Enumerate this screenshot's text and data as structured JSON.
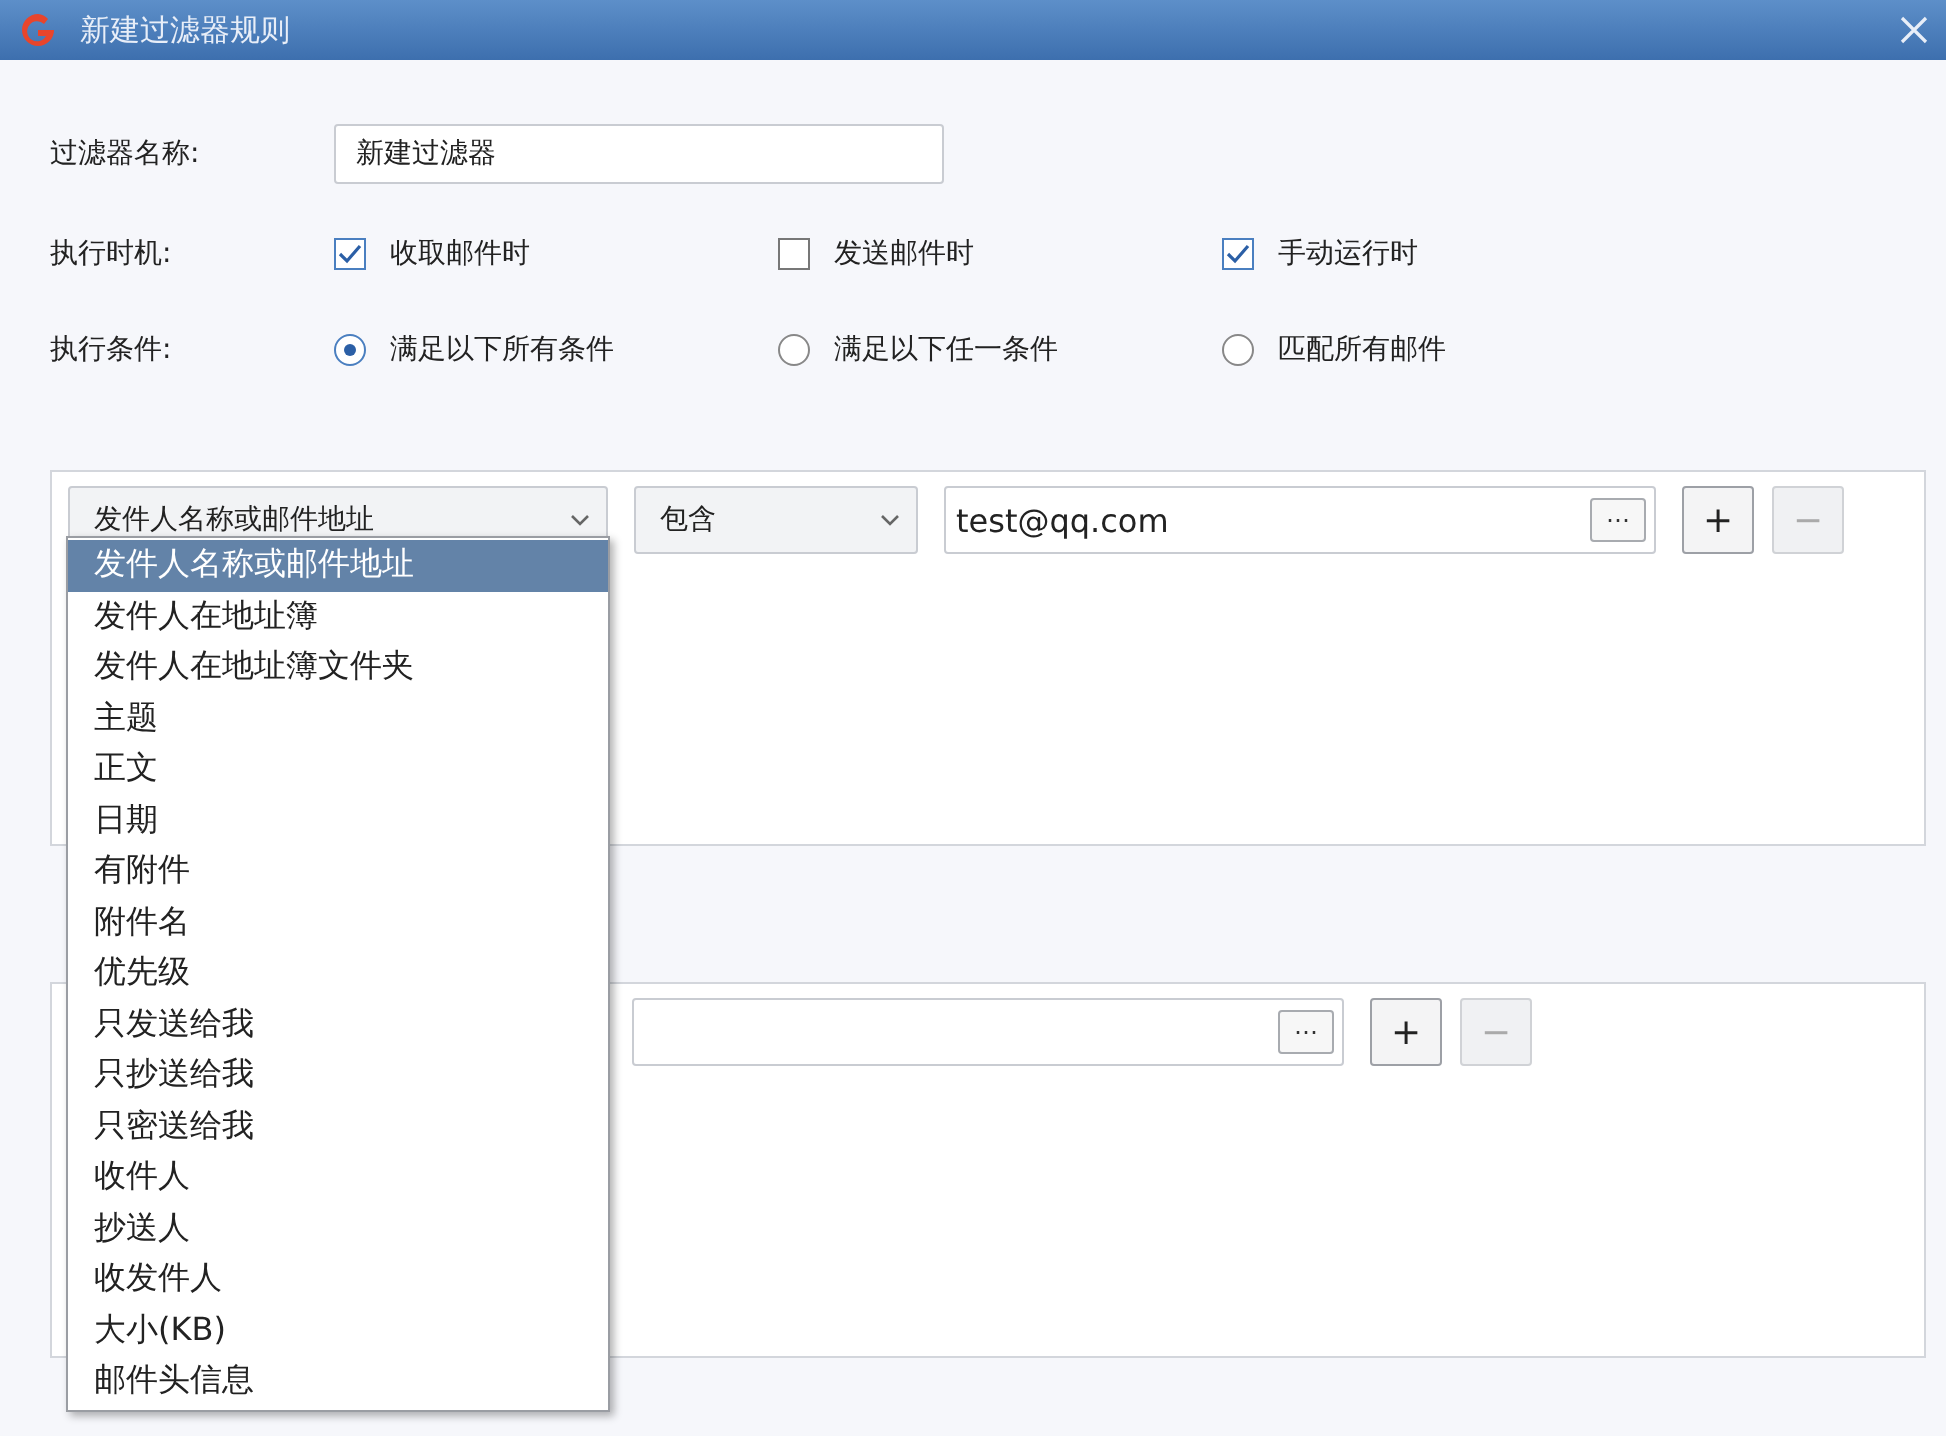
{
  "window": {
    "title": "新建过滤器规则"
  },
  "filter_name": {
    "label": "过滤器名称:",
    "value": "新建过滤器"
  },
  "timing": {
    "label": "执行时机:",
    "options": [
      {
        "label": "收取邮件时",
        "checked": true
      },
      {
        "label": "发送邮件时",
        "checked": false
      },
      {
        "label": "手动运行时",
        "checked": true
      }
    ]
  },
  "condition_mode": {
    "label": "执行条件:",
    "options": [
      {
        "label": "满足以下所有条件",
        "selected": true
      },
      {
        "label": "满足以下任一条件",
        "selected": false
      },
      {
        "label": "匹配所有邮件",
        "selected": false
      }
    ]
  },
  "conditions": [
    {
      "field": "发件人名称或邮件地址",
      "operator": "包含",
      "value": "test@qq.com",
      "browse": "⋯",
      "add": "+",
      "remove": "−",
      "remove_disabled": true
    }
  ],
  "actions": [
    {
      "browse": "⋯",
      "add": "+",
      "remove": "−",
      "remove_disabled": true
    }
  ],
  "field_dropdown": {
    "items": [
      {
        "label": "发件人名称或邮件地址",
        "selected": true
      },
      {
        "label": "发件人在地址簿",
        "selected": false
      },
      {
        "label": "发件人在地址簿文件夹",
        "selected": false
      },
      {
        "label": "主题",
        "selected": false
      },
      {
        "label": "正文",
        "selected": false
      },
      {
        "label": "日期",
        "selected": false
      },
      {
        "label": "有附件",
        "selected": false
      },
      {
        "label": "附件名",
        "selected": false
      },
      {
        "label": "优先级",
        "selected": false
      },
      {
        "label": "只发送给我",
        "selected": false
      },
      {
        "label": "只抄送给我",
        "selected": false
      },
      {
        "label": "只密送给我",
        "selected": false
      },
      {
        "label": "收件人",
        "selected": false
      },
      {
        "label": "抄送人",
        "selected": false
      },
      {
        "label": "收发件人",
        "selected": false
      },
      {
        "label": "大小(KB)",
        "selected": false
      },
      {
        "label": "邮件头信息",
        "selected": false
      }
    ]
  }
}
